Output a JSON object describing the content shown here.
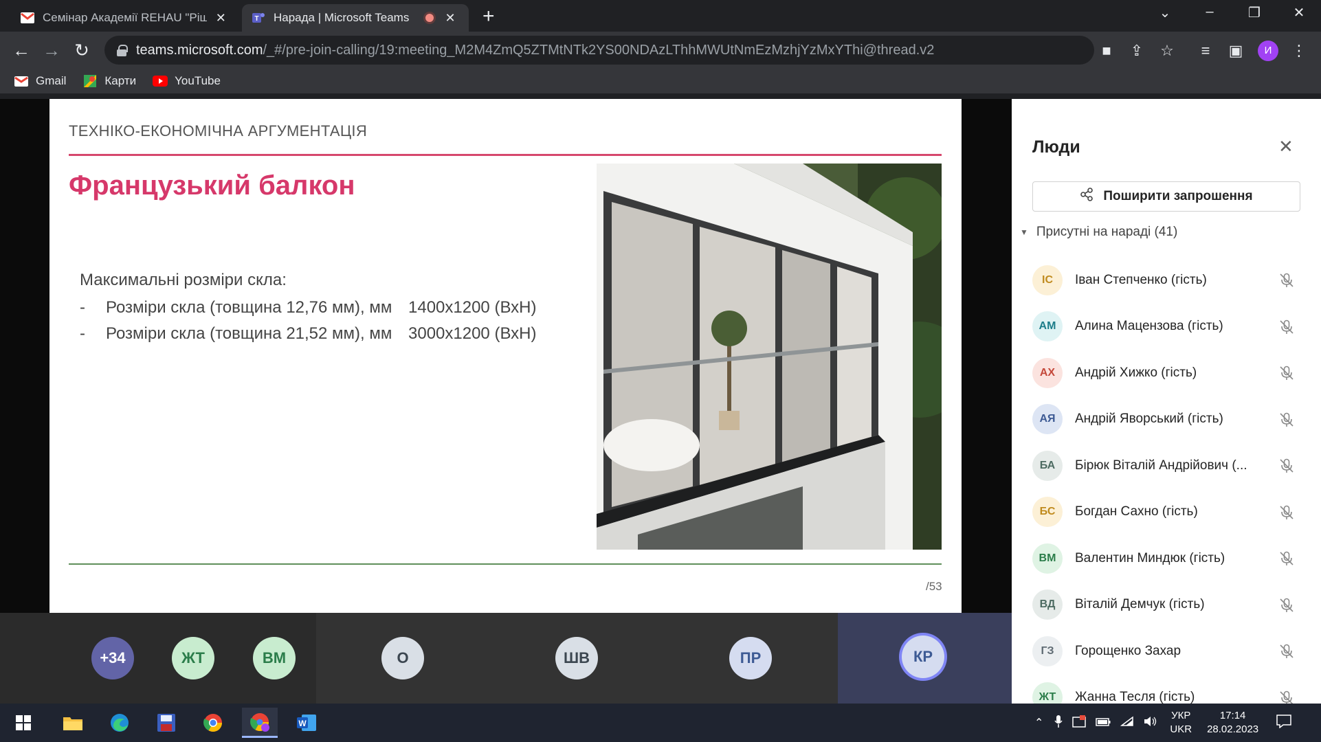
{
  "browser": {
    "tabs": [
      {
        "title": "Семінар Академії REHAU \"Рішен",
        "favicon": "gmail-icon"
      },
      {
        "title": "Нарада | Microsoft Teams",
        "favicon": "teams-icon"
      }
    ],
    "url_host": "teams.microsoft.com",
    "url_path": "/_#/pre-join-calling/19:meeting_M2M4ZmQ5ZTMtNTk2YS00NDAzLThhMWUtNmEzMzhjYzMxYThi@thread.v2",
    "profile_initial": "И",
    "bookmarks": [
      "Gmail",
      "Карти",
      "YouTube"
    ]
  },
  "slide": {
    "header": "ТЕХНІКО-ЕКОНОМІЧНА АРГУМЕНТАЦІЯ",
    "title": "Французький балкон",
    "intro": "Максимальні розміри скла:",
    "rows": [
      {
        "label": "Розміри скла (товщина 12,76 мм), мм",
        "value": "1400x1200 (ВхН)"
      },
      {
        "label": "Розміри скла (товщина 21,52 мм), мм",
        "value": "3000x1200 (ВхН)"
      }
    ],
    "dash": "-",
    "page": "/53"
  },
  "people_panel": {
    "title": "Люди",
    "share_label": "Поширити запрошення",
    "section_label": "Присутні на нараді (41)",
    "participants": [
      {
        "initials": "ІС",
        "name": "Іван Степченко (гість)",
        "bg": "#fcf0d6",
        "fg": "#c08b1e"
      },
      {
        "initials": "АМ",
        "name": "Алина Мацензова (гість)",
        "bg": "#dff3f4",
        "fg": "#1d7d8a"
      },
      {
        "initials": "АХ",
        "name": "Андрій Хижко (гість)",
        "bg": "#fbe3df",
        "fg": "#c4483a"
      },
      {
        "initials": "АЯ",
        "name": "Андрій Яворський (гість)",
        "bg": "#dde5f4",
        "fg": "#3d5a94"
      },
      {
        "initials": "БА",
        "name": "Бірюк Віталій Андрійович (...",
        "bg": "#e6ebe9",
        "fg": "#4d6b62"
      },
      {
        "initials": "БС",
        "name": "Богдан Сахно (гість)",
        "bg": "#fcf0d6",
        "fg": "#c08b1e"
      },
      {
        "initials": "ВМ",
        "name": "Валентин Миндюк (гість)",
        "bg": "#dff3e4",
        "fg": "#2b7d4a"
      },
      {
        "initials": "ВД",
        "name": "Віталій Демчук (гість)",
        "bg": "#e6ebe9",
        "fg": "#4d6b62"
      },
      {
        "initials": "ГЗ",
        "name": "Горощенко Захар",
        "bg": "#eceff1",
        "fg": "#5f6b73"
      },
      {
        "initials": "ЖТ",
        "name": "Жанна Тесля (гість)",
        "bg": "#dff3e4",
        "fg": "#2b7d4a"
      }
    ]
  },
  "participant_strip": [
    {
      "initials": "+34",
      "bg": "#6264a7",
      "fg": "#ffffff"
    },
    {
      "initials": "ЖТ",
      "bg": "#c8eccf",
      "fg": "#2b7d4a"
    },
    {
      "initials": "ВМ",
      "bg": "#c8eccf",
      "fg": "#2b7d4a"
    },
    {
      "initials": "О",
      "bg": "#d9dfe6",
      "fg": "#3b4650"
    },
    {
      "initials": "ШВ",
      "bg": "#d9dfe6",
      "fg": "#3b4650"
    },
    {
      "initials": "ПР",
      "bg": "#d5dcf0",
      "fg": "#3d5a94"
    },
    {
      "initials": "КР",
      "bg": "#d5dcf0",
      "fg": "#3d5a94"
    }
  ],
  "taskbar": {
    "lang_top": "УКР",
    "lang_bottom": "UKR",
    "time": "17:14",
    "date": "28.02.2023"
  },
  "colors": {
    "accent_pink": "#d6386a",
    "teams_purple": "#6264a7",
    "browser_dark": "#202124"
  }
}
